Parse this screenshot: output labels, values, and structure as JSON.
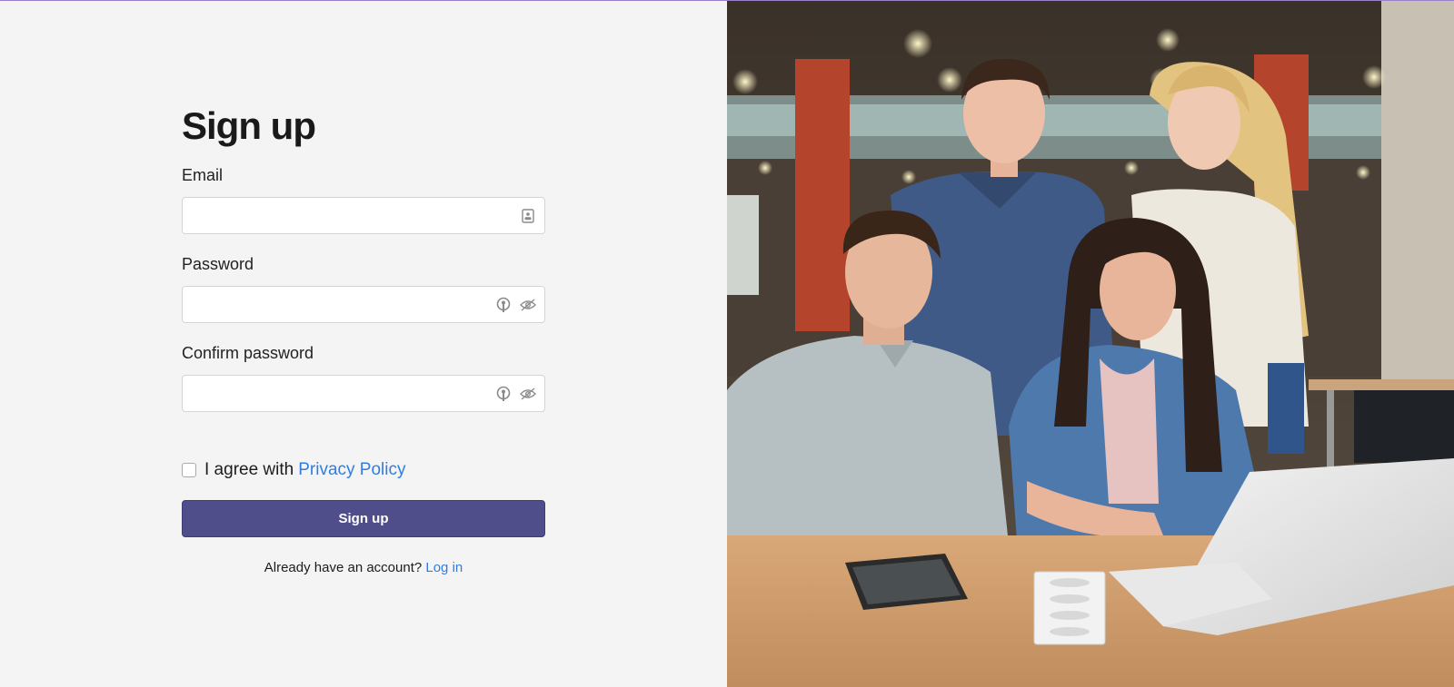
{
  "form": {
    "title": "Sign up",
    "email_label": "Email",
    "password_label": "Password",
    "confirm_label": "Confirm password",
    "agree_text": "I agree with",
    "privacy_link": "Privacy Policy",
    "submit_label": "Sign up",
    "login_prompt": "Already have an account?",
    "login_link": "Log in"
  },
  "icons": {
    "email_field": "contact-card-icon",
    "password_manager": "key-icon",
    "password_visibility": "eye-off-icon"
  },
  "colors": {
    "accent_button": "#504e8a",
    "link": "#2f7de1",
    "background": "#f4f4f4"
  }
}
